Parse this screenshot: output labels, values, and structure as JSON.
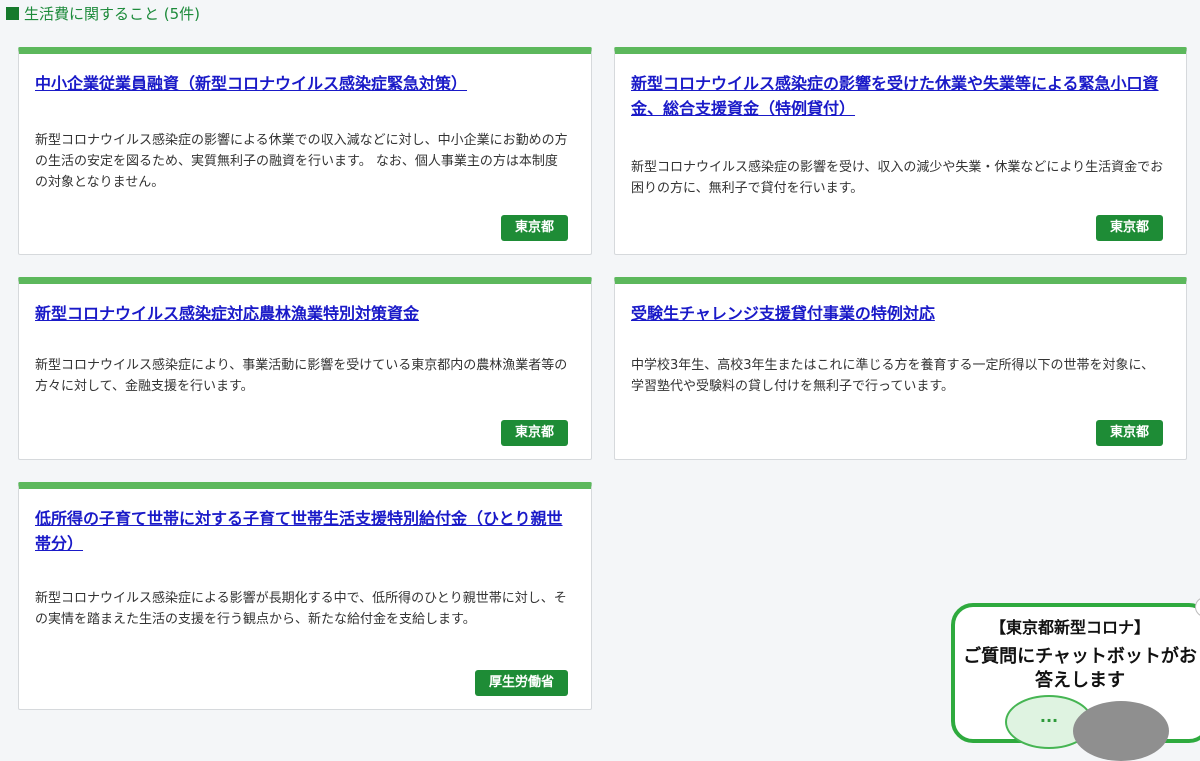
{
  "section": {
    "title": "生活費に関すること (5件)"
  },
  "cards": [
    {
      "title": "中小企業従業員融資（新型コロナウイルス感染症緊急対策）",
      "description": "新型コロナウイルス感染症の影響による休業での収入減などに対し、中小企業にお勤めの方の生活の安定を図るため、実質無利子の融資を行います。 なお、個人事業主の方は本制度の対象となりません。",
      "tag": "東京都"
    },
    {
      "title": "新型コロナウイルス感染症の影響を受けた休業や失業等による緊急小口資金、総合支援資金（特例貸付）",
      "description": "新型コロナウイルス感染症の影響を受け、収入の減少や失業・休業などにより生活資金でお困りの方に、無利子で貸付を行います。",
      "tag": "東京都"
    },
    {
      "title": "新型コロナウイルス感染症対応農林漁業特別対策資金",
      "description": "新型コロナウイルス感染症により、事業活動に影響を受けている東京都内の農林漁業者等の方々に対して、金融支援を行います。",
      "tag": "東京都"
    },
    {
      "title": "受験生チャレンジ支援貸付事業の特例対応",
      "description": "中学校3年生、高校3年生またはこれに準じる方を養育する一定所得以下の世帯を対象に、学習塾代や受験料の貸し付けを無利子で行っています。",
      "tag": "東京都"
    },
    {
      "title": "低所得の子育て世帯に対する子育て世帯生活支援特別給付金（ひとり親世帯分）",
      "description": "新型コロナウイルス感染症による影響が長期化する中で、低所得のひとり親世帯に対し、その実情を踏まえた生活の支援を行う観点から、新たな給付金を支給します。",
      "tag": "厚生労働省"
    }
  ],
  "chatbot": {
    "title": "【東京都新型コロナ】",
    "text": "ご質問にチャットボットがお答えします",
    "bubble_text": "..."
  },
  "colors": {
    "accent_green": "#5cb85c",
    "badge_green": "#1e8c36",
    "link_blue": "#1a1ac8"
  }
}
